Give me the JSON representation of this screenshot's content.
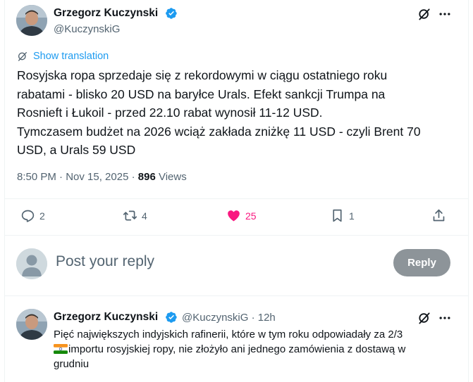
{
  "main_tweet": {
    "author_name": "Grzegorz Kuczynski",
    "handle": "@KuczynskiG",
    "show_translation_label": "Show translation",
    "text_lines": [
      "Rosyjska ropa sprzedaje się z rekordowymi w ciągu ostatniego roku",
      "rabatami - blisko 20 USD na baryłce Urals. Efekt sankcji Trumpa na",
      "Rosnieft i Łukoil - przed 22.10 rabat wynosił 11-12 USD.",
      "Tymczasem budżet na 2026 wciąż zakłada zniżkę 11 USD - czyli Brent 70",
      "USD, a Urals 59 USD"
    ],
    "timestamp": "8:50 PM · Nov 15, 2025 · ",
    "views_count": "896",
    "views_label": " Views"
  },
  "actions": {
    "replies": "2",
    "reposts": "4",
    "likes": "25",
    "bookmarks": "1"
  },
  "reply_composer": {
    "placeholder": "Post your reply",
    "button_label": "Reply"
  },
  "reply_tweet": {
    "author_name": "Grzegorz Kuczynski",
    "handle_time": "@KuczynskiG · 12h",
    "line1": "Pięć największych indyjskich rafinerii, które w tym roku odpowiadały za 2/3",
    "line2_rest": "importu rosyjskiej ropy, nie złożyło ani jednego zamówienia z dostawą w",
    "line3": "grudniu"
  },
  "colors": {
    "accent": "#1d9bf0",
    "like": "#f91880",
    "secondary_text": "#536471",
    "reply_button": "#8d9499"
  },
  "icons": [
    "grok-icon",
    "more-icon",
    "translate-icon",
    "verified-badge-icon",
    "reply-icon",
    "repost-icon",
    "heart-icon",
    "bookmark-icon",
    "share-icon",
    "india-flag-emoji"
  ]
}
